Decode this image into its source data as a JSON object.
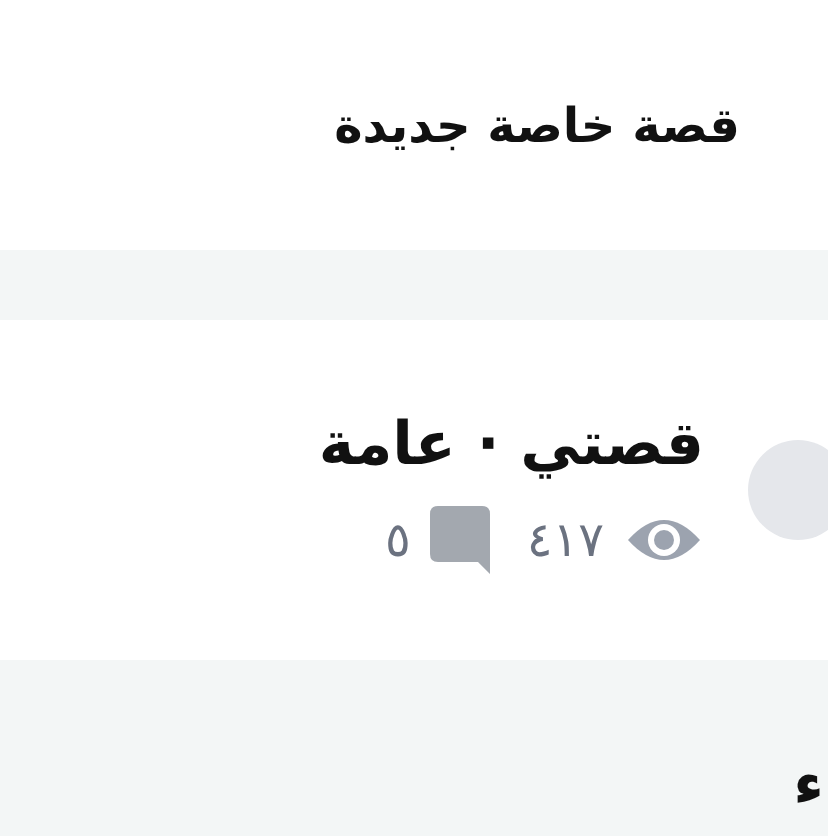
{
  "header": {
    "title": "قصة خاصة جديدة"
  },
  "story": {
    "title": "قصتي · عامة",
    "views": "٤١٧",
    "comments": "٥"
  },
  "next_section": {
    "text": "ء"
  }
}
